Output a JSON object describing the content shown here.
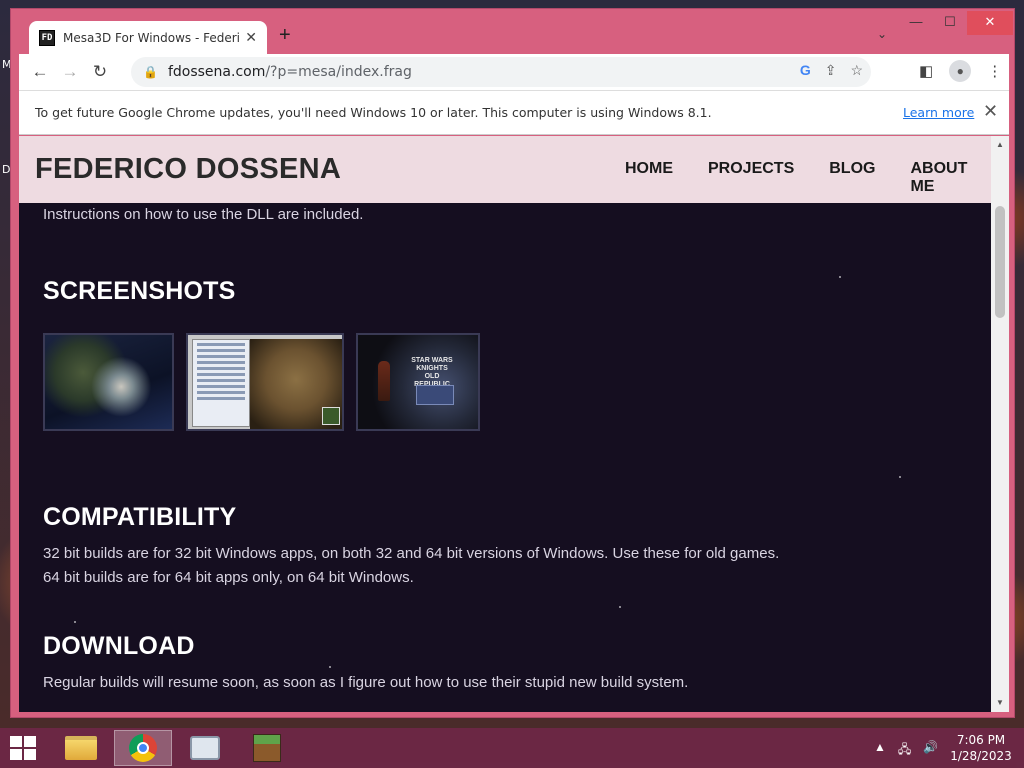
{
  "desktop": {
    "left_labels": [
      "M",
      "D"
    ]
  },
  "browser": {
    "tab": {
      "favicon": "FD",
      "title": "Mesa3D For Windows - Federico",
      "close": "✕"
    },
    "newtab": "+",
    "tab_dropdown": "⌄",
    "window_controls": {
      "minimize": "—",
      "maximize": "☐",
      "close": "✕"
    },
    "nav": {
      "back": "←",
      "forward": "→",
      "reload": "↻"
    },
    "url": {
      "host": "fdossena.com",
      "path": "/?p=mesa/index.frag"
    },
    "omnibox_icons": {
      "google": "G",
      "share": "⇪",
      "bookmark": "☆"
    },
    "toolbar_icons": {
      "sidepanel": "◧",
      "profile": "👤",
      "menu": "⋮"
    },
    "infobar": {
      "text": "To get future Google Chrome updates, you'll need Windows 10 or later. This computer is using Windows 8.1.",
      "learn_more": "Learn more",
      "close": "✕"
    }
  },
  "site": {
    "title": "FEDERICO DOSSENA",
    "nav": [
      "HOME",
      "PROJECTS",
      "BLOG",
      "ABOUT ME"
    ],
    "intro_line": "Instructions on how to use the DLL are included.",
    "screenshots_heading": "SCREENSHOTS",
    "shot3_logo": "STAR WARS KNIGHTS OLD REPUBLIC",
    "compat_heading": "COMPATIBILITY",
    "compat_lines": [
      "32 bit builds are for 32 bit Windows apps, on both 32 and 64 bit versions of Windows. Use these for old games.",
      "64 bit builds are for 64 bit apps only, on 64 bit Windows."
    ],
    "download_heading": "DOWNLOAD",
    "download_text": "Regular builds will resume soon, as soon as I figure out how to use their stupid new build system."
  },
  "scrollbar": {
    "up": "▲",
    "down": "▼"
  },
  "taskbar": {
    "tray_icons": {
      "up_arrow": "▲",
      "network": "🖧",
      "volume": "🔊"
    },
    "time": "7:06 PM",
    "date": "1/28/2023"
  }
}
